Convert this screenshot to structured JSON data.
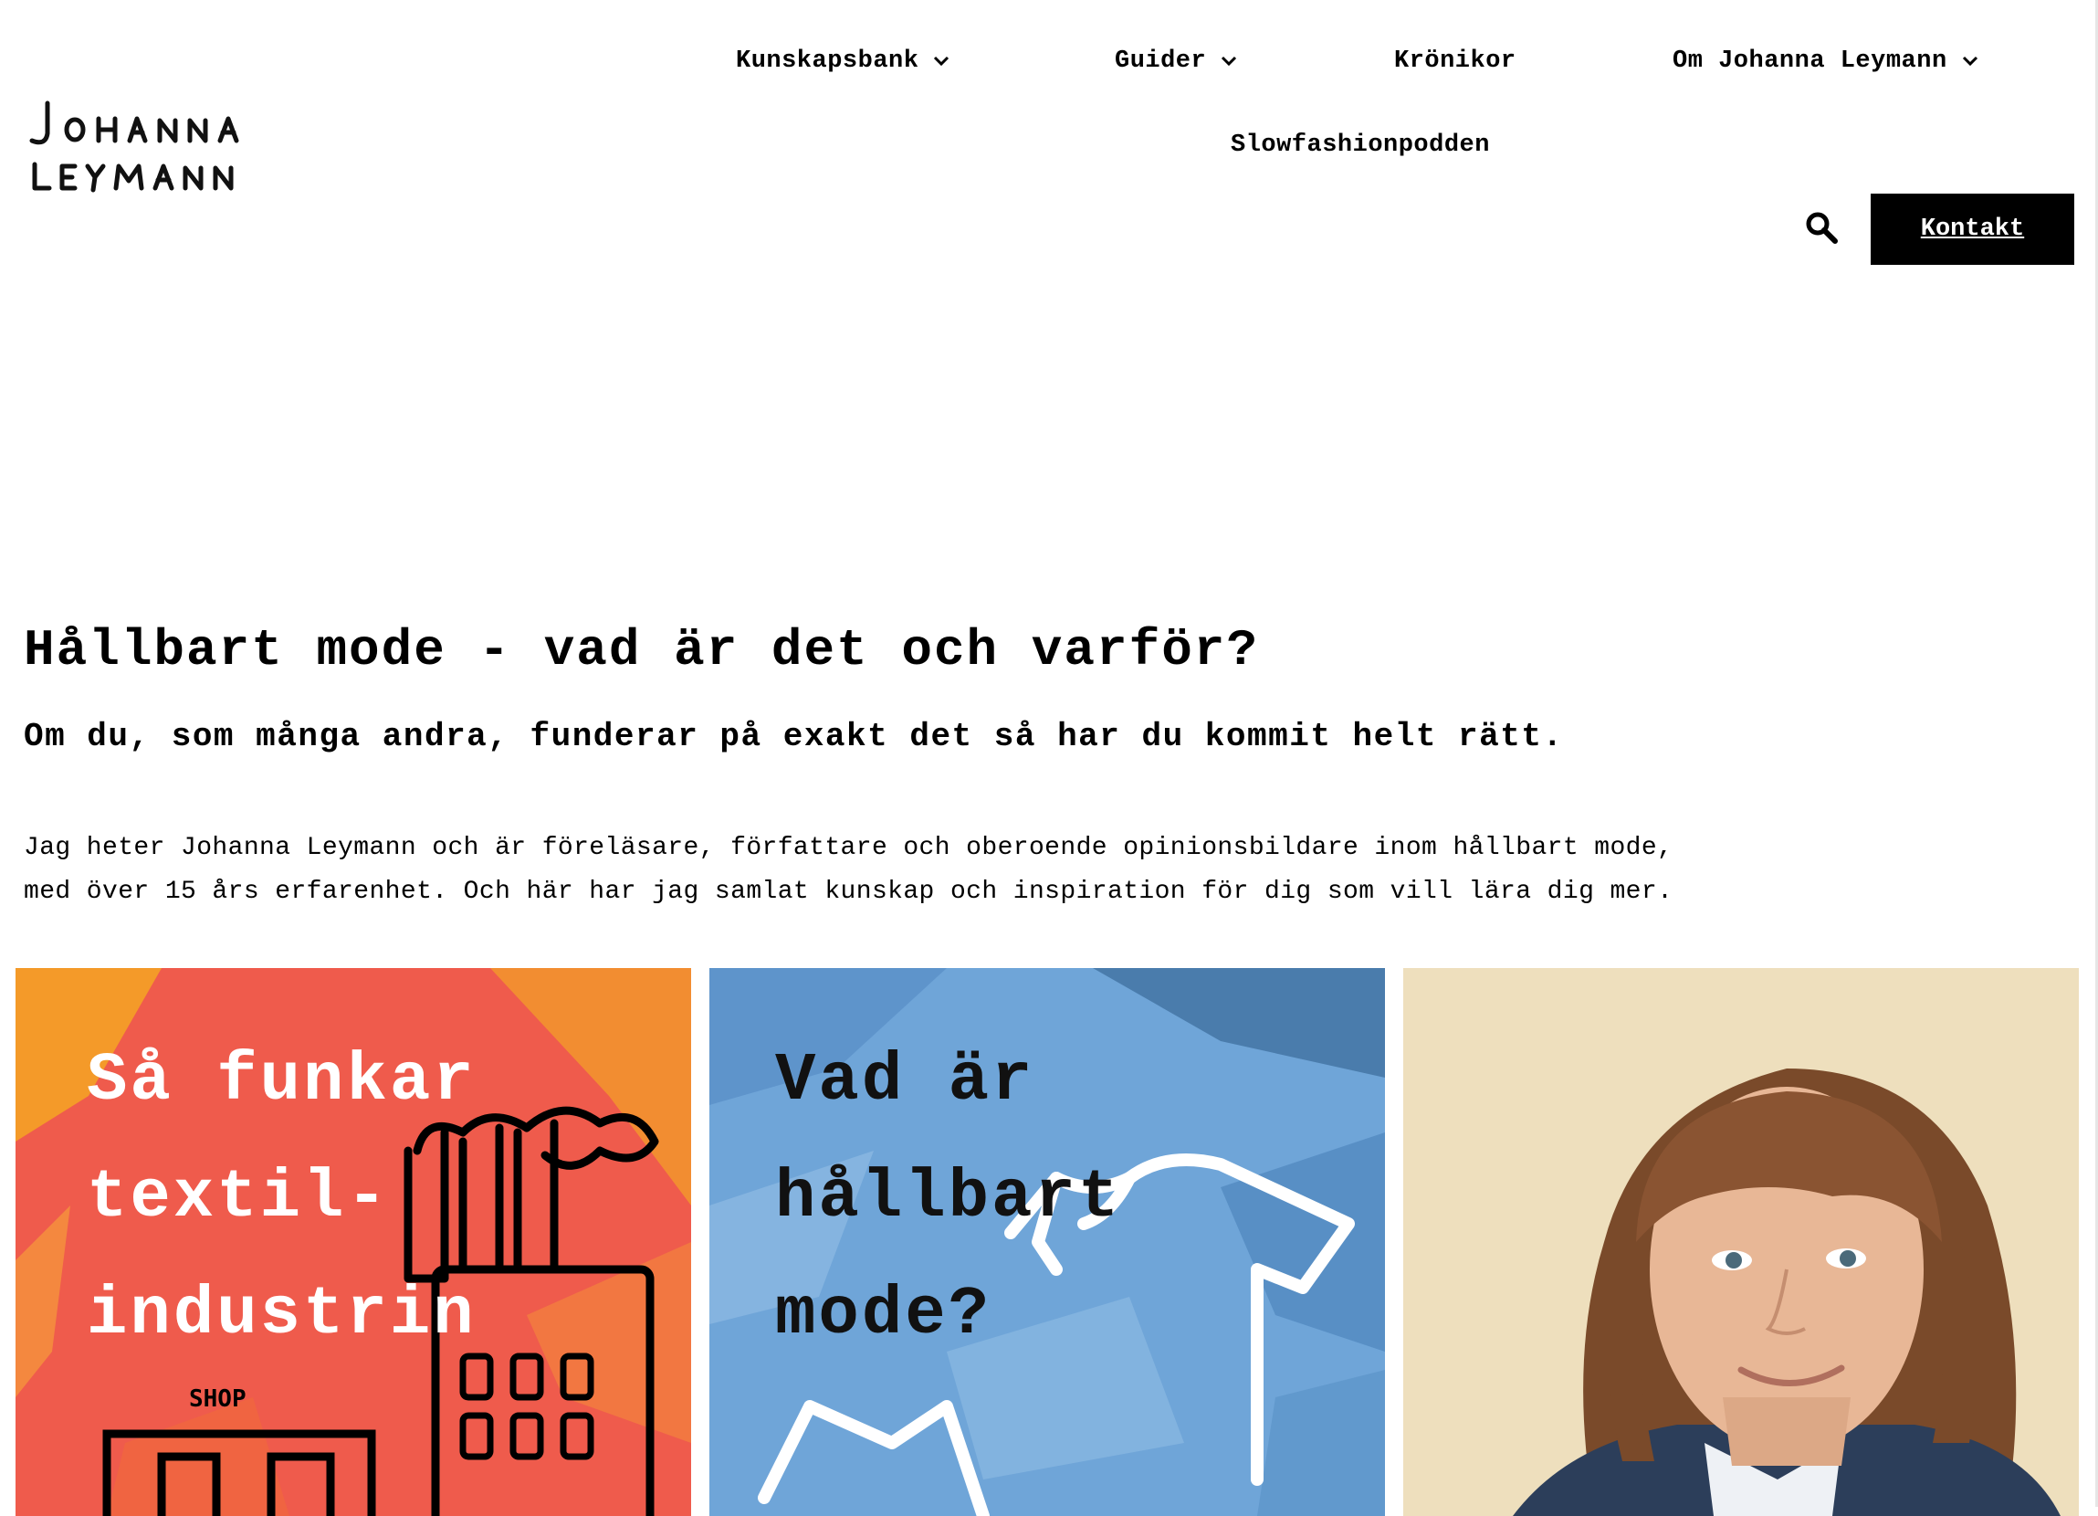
{
  "brand": {
    "logo_line1": "JOHANNA",
    "logo_line2": "LEYMANN"
  },
  "nav": {
    "items": [
      {
        "label": "Kunskapsbank",
        "has_dropdown": true
      },
      {
        "label": "Guider",
        "has_dropdown": true
      },
      {
        "label": "Krönikor",
        "has_dropdown": false
      },
      {
        "label": "Om Johanna Leymann",
        "has_dropdown": true
      },
      {
        "label": "Slowfashionpodden",
        "has_dropdown": false
      }
    ],
    "contact_label": "Kontakt",
    "search_icon": "search-icon"
  },
  "intro": {
    "title": "Hållbart mode - vad är det och varför?",
    "subtitle": "Om du, som många andra, funderar på exakt det så har du kommit helt rätt.",
    "body_lines": [
      "Jag heter Johanna Leymann och är föreläsare, författare och oberoende opinionsbildare inom hållbart mode,",
      "med över 15 års erfarenhet. Och här har jag samlat kunskap och inspiration för dig som vill lära dig mer."
    ]
  },
  "cards": [
    {
      "title_lines": [
        "Så funkar",
        "textil-",
        "industrin"
      ],
      "illustration_text": "SHOP",
      "bg": "#ef5b4c",
      "accent": "#f5a623"
    },
    {
      "title_lines": [
        "Vad är",
        "hållbart",
        "mode?"
      ],
      "bg": "#6fa5d8",
      "accent": "#3d6f9e"
    },
    {
      "image": "portrait-photo",
      "bg": "#f0e3c4"
    }
  ],
  "colors": {
    "text": "#000000",
    "button_bg": "#000000",
    "button_text": "#ffffff"
  }
}
